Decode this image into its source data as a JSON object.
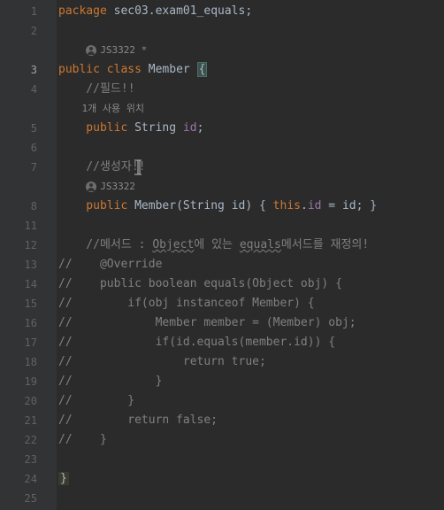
{
  "gutter": {
    "lines": [
      "1",
      "2",
      "",
      "3",
      "4",
      "",
      "5",
      "6",
      "7",
      "",
      "8",
      "11",
      "12",
      "13",
      "14",
      "15",
      "16",
      "17",
      "18",
      "19",
      "20",
      "21",
      "22",
      "23",
      "24",
      "25"
    ],
    "active_line": "3"
  },
  "code": {
    "l1_package": "package",
    "l1_pkg": " sec03.exam01_equals",
    "l1_semi": ";",
    "author1_name": "JS3322 *",
    "l3_public": "public",
    "l3_class": " class",
    "l3_name": " Member ",
    "l3_brace": "{",
    "l4_comment": "    //필드!!",
    "usage_text": "    1개 사용 위치",
    "l5_public": "    public",
    "l5_type": " String ",
    "l5_field": "id",
    "l5_semi": ";",
    "l7_comment": "    //생성자!!",
    "author2_name": "JS3322",
    "l8_public": "    public",
    "l8_ctor": " Member",
    "l8_paren_o": "(",
    "l8_ptype": "String ",
    "l8_pname": "id",
    "l8_paren_c": ") ",
    "l8_brace_o": "{ ",
    "l8_this": "this",
    "l8_dot": ".",
    "l8_fld": "id",
    "l8_eq": " = ",
    "l8_rhs": "id",
    "l8_semi": "; ",
    "l8_brace_c": "}",
    "l12_pre": "    //메서드 : ",
    "l12_obj": "Object",
    "l12_mid": "에 있는 ",
    "l12_eq": "equals",
    "l12_post": "메서드를 재정의!",
    "l13": "//    @Override",
    "l14": "//    public boolean equals(Object obj) {",
    "l15": "//        if(obj instanceof Member) {",
    "l16": "//            Member member = (Member) obj;",
    "l17": "//            if(id.equals(member.id)) {",
    "l18": "//                return true;",
    "l19": "//            }",
    "l20": "//        }",
    "l21": "//        return false;",
    "l22": "//    }",
    "l24_brace": "}"
  }
}
